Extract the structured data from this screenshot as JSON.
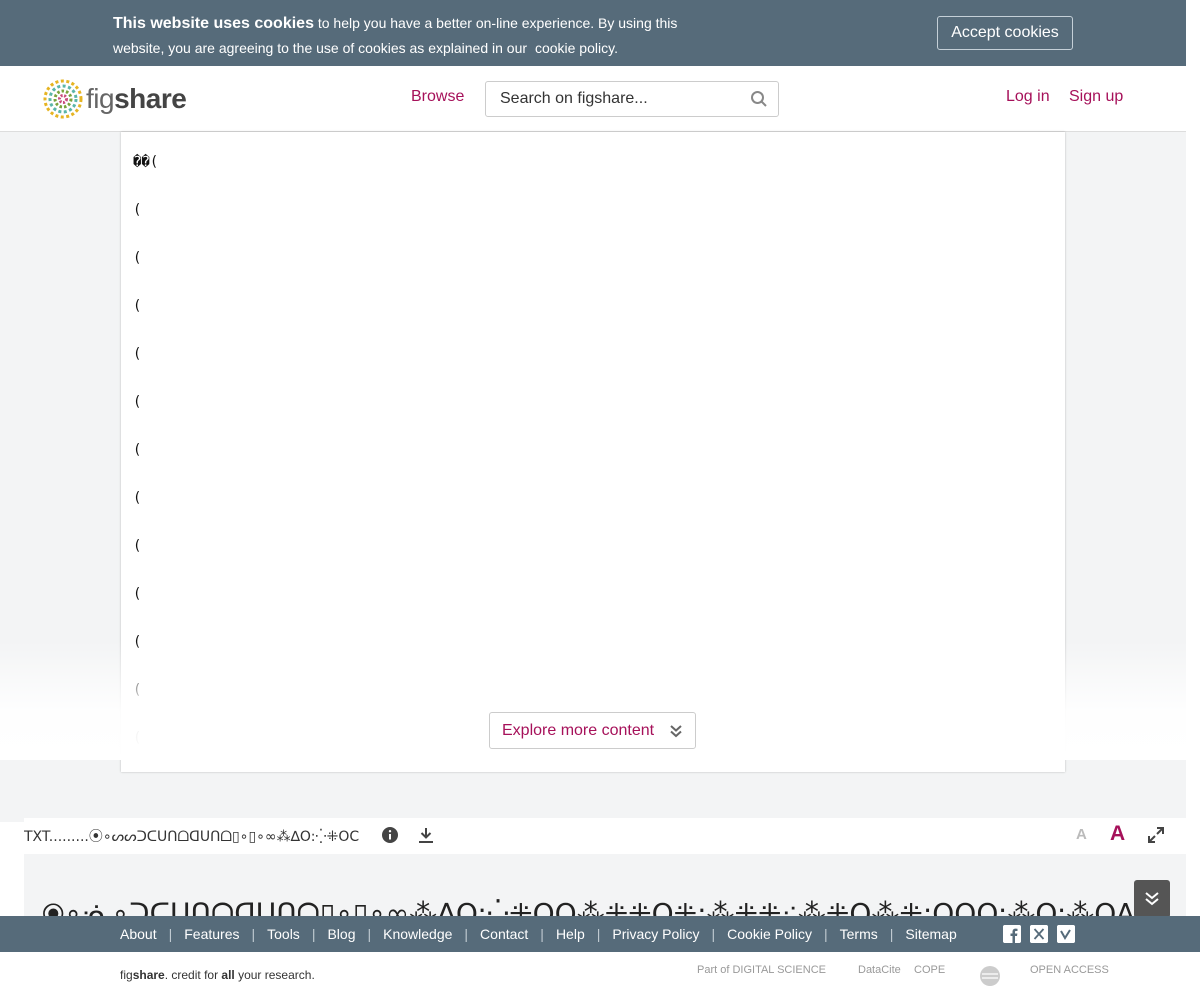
{
  "cookie_banner": {
    "heading": "This website uses cookies",
    "text": "to help you have a better on-line experience. By using this website, you are agreeing to the use of cookies as explained in our",
    "link": "cookie policy",
    "period": ".",
    "accept_label": "Accept cookies"
  },
  "header": {
    "logo_fig": "fig",
    "logo_share": "share",
    "browse_label": "Browse",
    "search_placeholder": "Search on figshare...",
    "login_label": "Log in",
    "signup_label": "Sign up"
  },
  "document": {
    "lines": [
      "��(",
      "(",
      "(",
      "(",
      "(",
      "(",
      "(",
      "(",
      "(",
      "(",
      "(",
      "(",
      "("
    ]
  },
  "explore_label": "Explore more content",
  "file_bar": {
    "file_name": "TXT.........⦿∘ᔕᔕᑐᑕᑌᑎᗝᗡᑌᑎᗝ▯∘▯∘∞⁂∆O:⁛⁜OC",
    "font_small_label": "A",
    "font_large_label": "A"
  },
  "title": "⦿∘ᓍ∘ᑐᑕᑌᑎᗝᗡᑌᑎᗝ▯∘▯∘∞⁂∆O:⁛⁜OO⁂⁜⁜O⁜:⁂⁜⁜⁖⁂⁜O⁂⁜:OOO:⁂O:⁂OA::⁂⁂",
  "footer": {
    "links": [
      "About",
      "Features",
      "Tools",
      "Blog",
      "Knowledge",
      "Contact",
      "Help",
      "Privacy Policy",
      "Cookie Policy",
      "Terms",
      "Sitemap"
    ],
    "tagline_fig": "fig",
    "tagline_share": "share",
    "tagline_mid": ". credit for ",
    "tagline_all": "all",
    "tagline_end": " your research.",
    "partners": [
      "Part of DIGITAL SCIENCE",
      "DataCite",
      "COPE",
      "",
      "OPEN ACCESS"
    ]
  }
}
